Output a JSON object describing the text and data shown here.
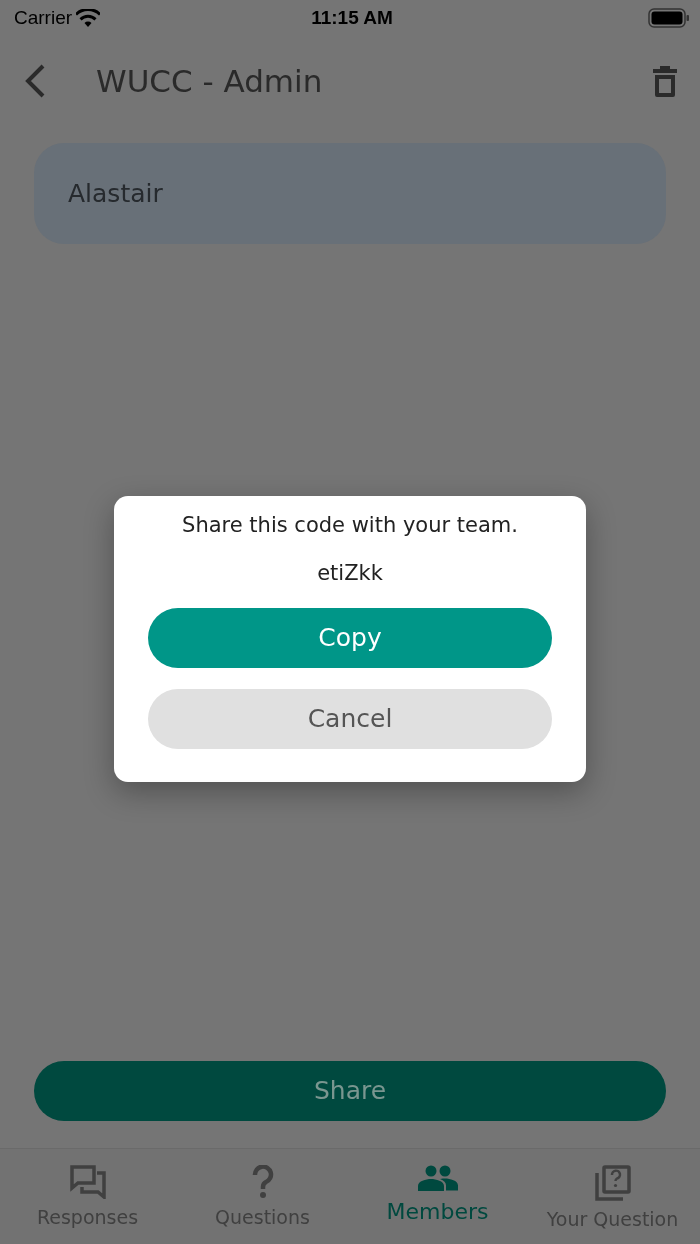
{
  "status_bar": {
    "carrier": "Carrier",
    "time": "11:15 AM"
  },
  "header": {
    "title": "WUCC - Admin"
  },
  "members": [
    {
      "name": "Alastair"
    }
  ],
  "share_button": "Share",
  "dialog": {
    "message": "Share this code with your team.",
    "code": "etiZkk",
    "buttons": [
      {
        "label": "Copy",
        "kind": "primary"
      },
      {
        "label": "Cancel",
        "kind": "secondary"
      }
    ]
  },
  "tabs": [
    {
      "label": "Responses",
      "selected": false
    },
    {
      "label": "Questions",
      "selected": false
    },
    {
      "label": "Members",
      "selected": true
    },
    {
      "label": "Your Question",
      "selected": false
    }
  ]
}
